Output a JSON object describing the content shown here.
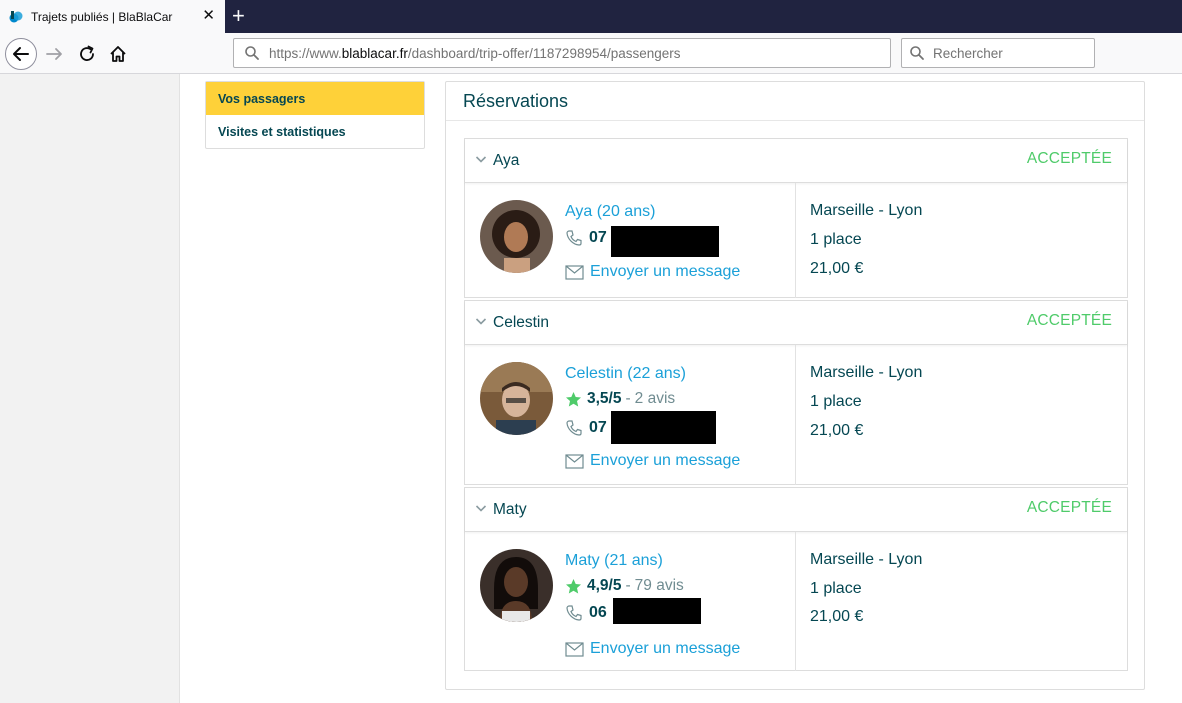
{
  "browser": {
    "tab_title": "Trajets publiés | BlaBlaCar",
    "tab_close": "✕",
    "new_tab": "+",
    "url_prefix": "https://www.",
    "url_domain": "blablacar.fr",
    "url_path": "/dashboard/trip-offer/1187298954/passengers",
    "search_placeholder": "Rechercher"
  },
  "sidebar": {
    "items": [
      {
        "label": "Vos passagers",
        "active": true
      },
      {
        "label": "Visites et statistiques",
        "active": false
      }
    ]
  },
  "main": {
    "title": "Réservations",
    "bookings": [
      {
        "name": "Aya",
        "status": "ACCEPTÉE",
        "passenger": "Aya (20 ans)",
        "rating": null,
        "phone_prefix": "07",
        "message": "Envoyer un message",
        "route": "Marseille - Lyon",
        "seats": "1 place",
        "price": "21,00 €"
      },
      {
        "name": "Celestin",
        "status": "ACCEPTÉE",
        "passenger": "Celestin (22 ans)",
        "rating": {
          "score": "3,5/5",
          "sep": "-",
          "reviews": "2 avis"
        },
        "phone_prefix": "07",
        "message": "Envoyer un message",
        "route": "Marseille - Lyon",
        "seats": "1 place",
        "price": "21,00 €"
      },
      {
        "name": "Maty",
        "status": "ACCEPTÉE",
        "passenger": "Maty (21 ans)",
        "rating": {
          "score": "4,9/5",
          "sep": "-",
          "reviews": "79 avis"
        },
        "phone_prefix": "06",
        "message": "Envoyer un message",
        "route": "Marseille - Lyon",
        "seats": "1 place",
        "price": "21,00 €"
      }
    ]
  },
  "colors": {
    "brand_yellow": "#fed139",
    "link_blue": "#1ba0d8",
    "accepted_green": "#4fcb6a",
    "text_dark": "#054752"
  }
}
